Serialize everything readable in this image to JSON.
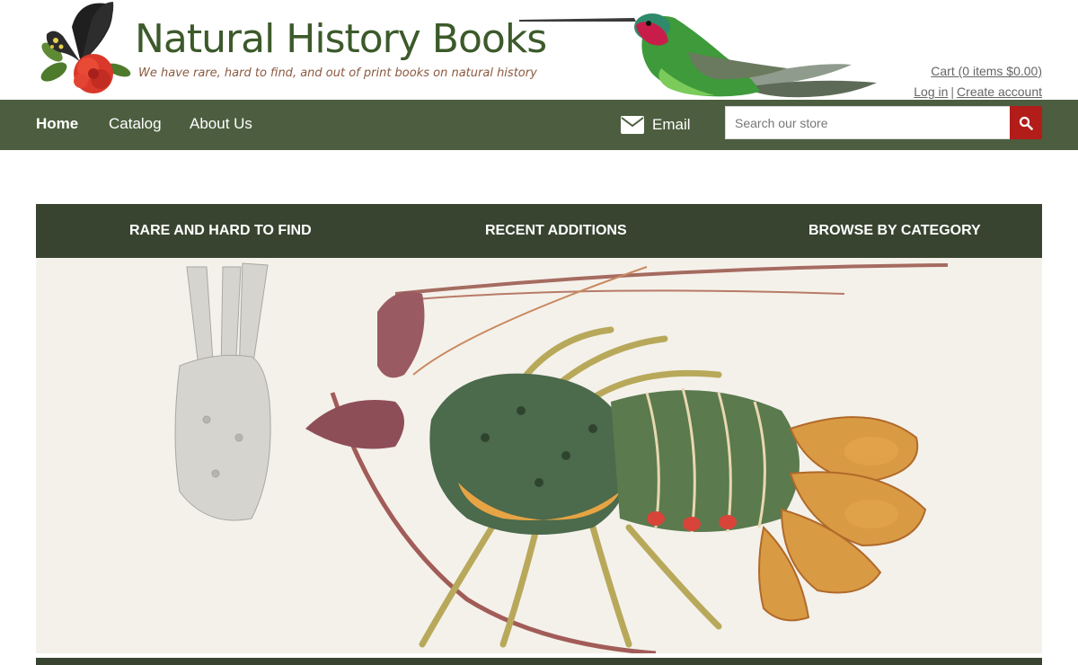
{
  "header": {
    "logo_title": "Natural History Books",
    "logo_tagline": "We have rare, hard to find, and out of print books on natural history",
    "cart_label": "Cart (0 items $0.00)",
    "login_label": "Log in",
    "separator": "|",
    "create_account_label": "Create account"
  },
  "nav": {
    "items": [
      {
        "label": "Home",
        "active": true
      },
      {
        "label": "Catalog",
        "active": false
      },
      {
        "label": "About Us",
        "active": false
      }
    ],
    "email_label": "Email",
    "email_icon": "envelope-icon"
  },
  "search": {
    "placeholder": "Search our store",
    "value": "",
    "button_icon": "search-icon"
  },
  "subnav": {
    "items": [
      {
        "label": "RARE AND HARD TO FIND"
      },
      {
        "label": "RECENT ADDITIONS"
      },
      {
        "label": "BROWSE BY CATEGORY"
      }
    ]
  },
  "colors": {
    "nav_bg": "#4c5e3f",
    "subnav_bg": "#384430",
    "search_button": "#b21d1a",
    "logo_green": "#3c5a2a",
    "tagline_brown": "#8b5a40"
  }
}
